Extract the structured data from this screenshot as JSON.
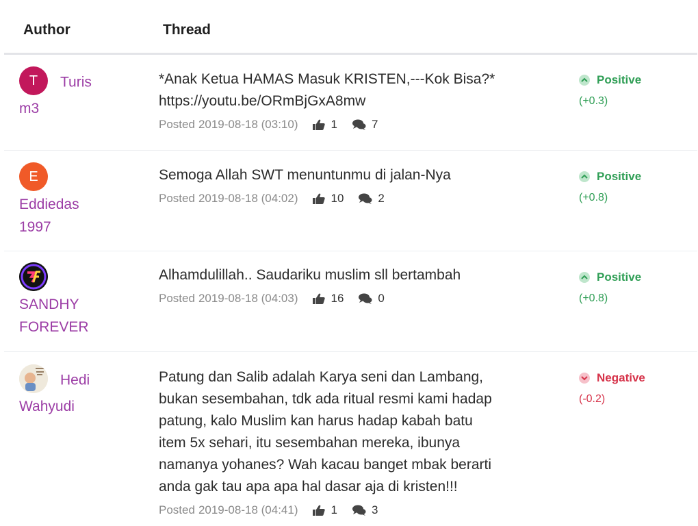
{
  "header": {
    "author": "Author",
    "thread": "Thread"
  },
  "rows": [
    {
      "avatar_letter": "T",
      "avatar_color": "#c2185b",
      "author_line1": "Turis",
      "author_line2": "m3",
      "text_lines": [
        "*Anak Ketua HAMAS Masuk KRISTEN,---Kok Bisa?*",
        "https://youtu.be/ORmBjGxA8mw"
      ],
      "posted_label": "Posted",
      "posted": "2019-08-18 (03:10)",
      "likes": "1",
      "comments": "7",
      "sentiment": "Positive",
      "score": "(+0.3)"
    },
    {
      "avatar_letter": "E",
      "avatar_color": "#f05a28",
      "author_line1": "Eddiedas",
      "author_line2": "1997",
      "text_lines": [
        "Semoga Allah SWT menuntunmu di jalan-Nya"
      ],
      "posted_label": "Posted",
      "posted": "2019-08-18 (04:02)",
      "likes": "10",
      "comments": "2",
      "sentiment": "Positive",
      "score": "(+0.8)"
    },
    {
      "avatar_letter": "SF",
      "avatar_color": "#1a1a1a",
      "author_line1": "SANDHY",
      "author_line2": "FOREVER",
      "text_lines": [
        "Alhamdulillah.. Saudariku muslim sll bertambah"
      ],
      "posted_label": "Posted",
      "posted": "2019-08-18 (04:03)",
      "likes": "16",
      "comments": "0",
      "sentiment": "Positive",
      "score": "(+0.8)"
    },
    {
      "avatar_letter": "",
      "avatar_color": "#e9e3d6",
      "author_line1": "Hedi",
      "author_line2": "Wahyudi",
      "text_lines": [
        "Patung dan Salib adalah Karya seni dan Lambang,",
        "bukan sesembahan, tdk ada ritual resmi kami hadap",
        "patung, kalo Muslim kan harus hadap kabah batu",
        "item 5x sehari, itu sesembahan mereka, ibunya",
        "namanya yohanes? Wah kacau banget mbak berarti",
        "anda gak tau apa apa hal dasar aja di kristen!!!"
      ],
      "posted_label": "Posted",
      "posted": "2019-08-18 (04:41)",
      "likes": "1",
      "comments": "3",
      "sentiment": "Negative",
      "score": "(-0.2)"
    }
  ],
  "colors": {
    "positive": "#2f9e55",
    "negative": "#d6334a",
    "author_link": "#9b3ca5"
  }
}
